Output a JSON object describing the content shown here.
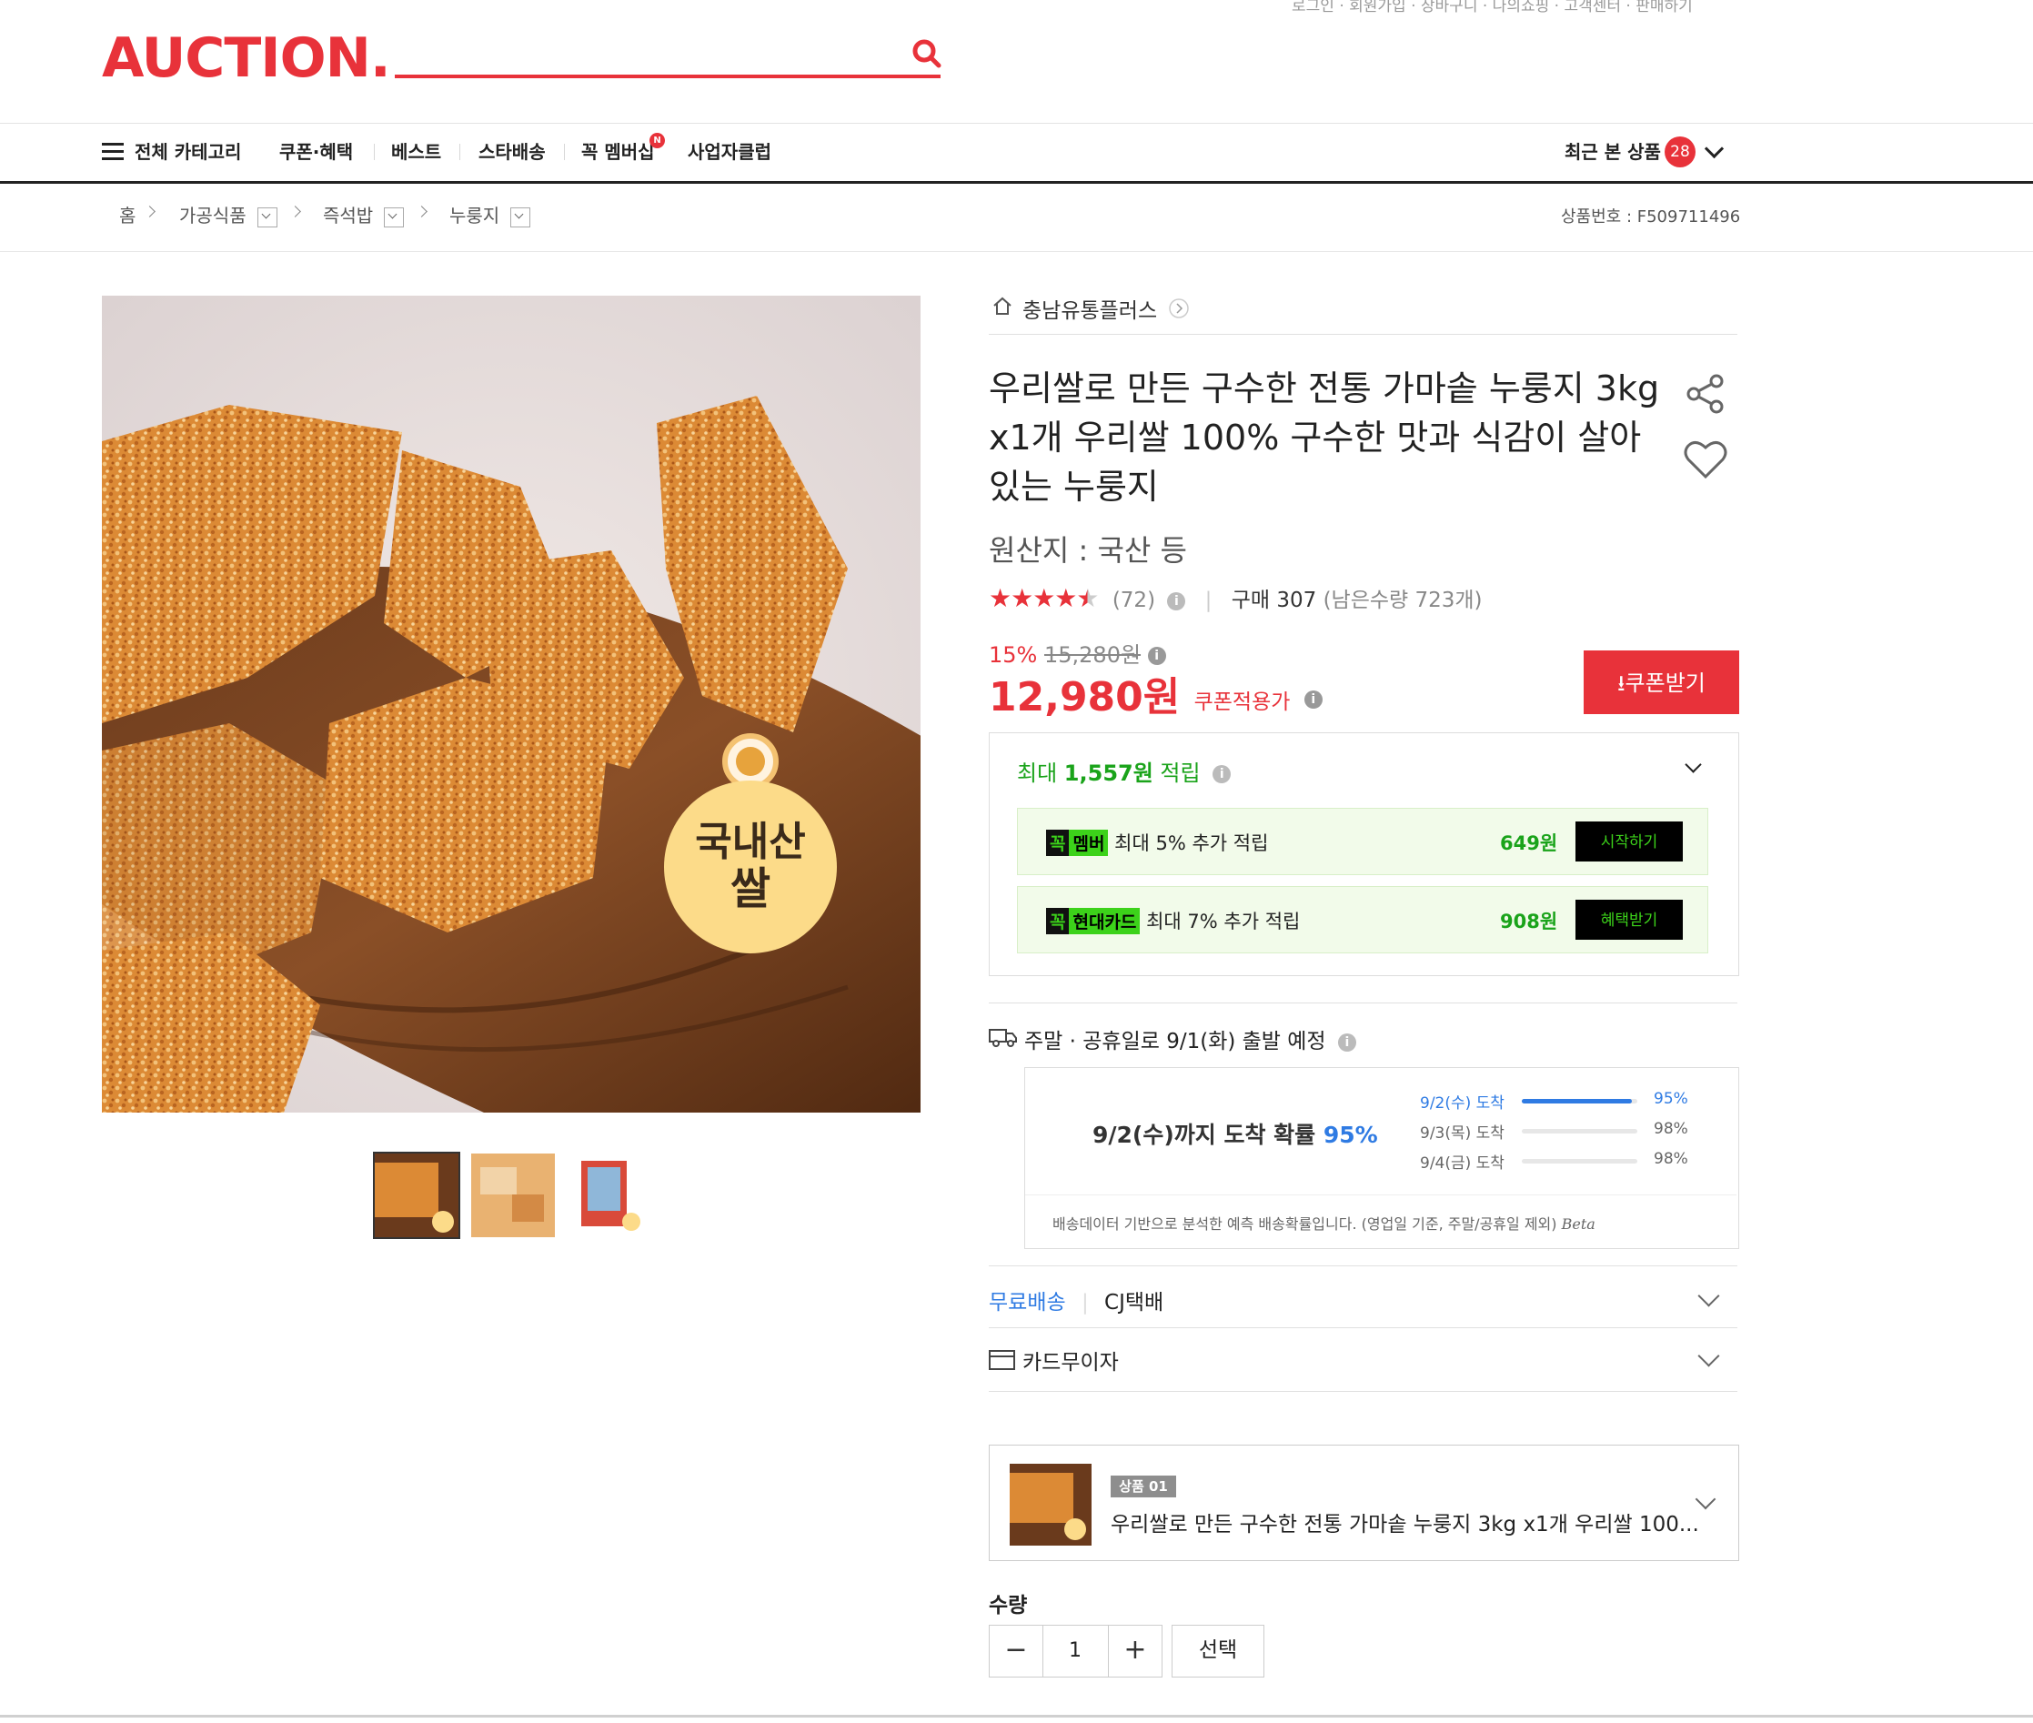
{
  "header": {
    "logo": "AUCTION.",
    "top_links": "로그인 · 회원가입 · 장바구니 · 나의쇼핑 · 고객센터 · 판매하기"
  },
  "nav": {
    "all_categories": "전체 카테고리",
    "items": [
      "쿠폰·혜택",
      "베스트",
      "스타배송",
      "꼭 멤버십",
      "사업자클럽"
    ],
    "new_badge": "N",
    "recent": "최근 본 상품",
    "recent_count": "28"
  },
  "breadcrumb": {
    "home": "홈",
    "items": [
      "가공식품",
      "즉석밥",
      "누룽지"
    ],
    "product_no": "상품번호 : F509711496"
  },
  "product": {
    "seller": "충남유통플러스",
    "title": "우리쌀로 만든 구수한 전통 가마솥 누룽지 3kg x1개 우리쌀 100% 구수한 맛과 식감이 살아있는 누룽지",
    "origin": "원산지 : 국산 등",
    "rating": 4.5,
    "review_count": "(72)",
    "purchases": "구매 307",
    "remaining": "(남은수량 723개)",
    "discount_rate": "15%",
    "original_price": "15,280원",
    "price": "12,980원",
    "coupon_price_label": "쿠폰적용가",
    "coupon_button": "쿠폰받기",
    "image_badge": "국내산 쌀"
  },
  "points": {
    "summary_prefix": "최대 ",
    "summary_amount": "1,557원",
    "summary_suffix": " 적립",
    "rows": [
      {
        "tag1": "꼭",
        "tag2": "멤버",
        "label": "최대 5% 추가 적립",
        "amount": "649원",
        "button": "시작하기"
      },
      {
        "tag1": "꼭",
        "tag2": "현대카드",
        "label": "최대 7% 추가 적립",
        "amount": "908원",
        "button": "혜택받기"
      }
    ]
  },
  "shipping": {
    "notice": "주말 · 공휴일로 9/1(화) 출발 예정",
    "prob_text": "9/2(수)까지 도착 확률 ",
    "prob_value": "95%",
    "bars": [
      {
        "label": "9/2(수) 도착",
        "value": 0.95,
        "pct": "95%",
        "highlight": true
      },
      {
        "label": "9/3(목) 도착",
        "value": 0.98,
        "pct": "98%",
        "highlight": false
      },
      {
        "label": "9/4(금) 도착",
        "value": 0.98,
        "pct": "98%",
        "highlight": false
      }
    ],
    "note": "배송데이터 기반으로 분석한 예측 배송확률입니다. (영업일 기준, 주말/공휴일 제외)",
    "beta": "Beta",
    "free_shipping": "무료배송",
    "carrier": "CJ택배",
    "card_installment": "카드무이자"
  },
  "option": {
    "badge": "상품 01",
    "name": "우리쌀로 만든 구수한 전통 가마솥 누룽지 3kg x1개 우리쌀 100..."
  },
  "quantity": {
    "label": "수량",
    "minus": "−",
    "value": "1",
    "plus": "+",
    "select": "선택"
  }
}
